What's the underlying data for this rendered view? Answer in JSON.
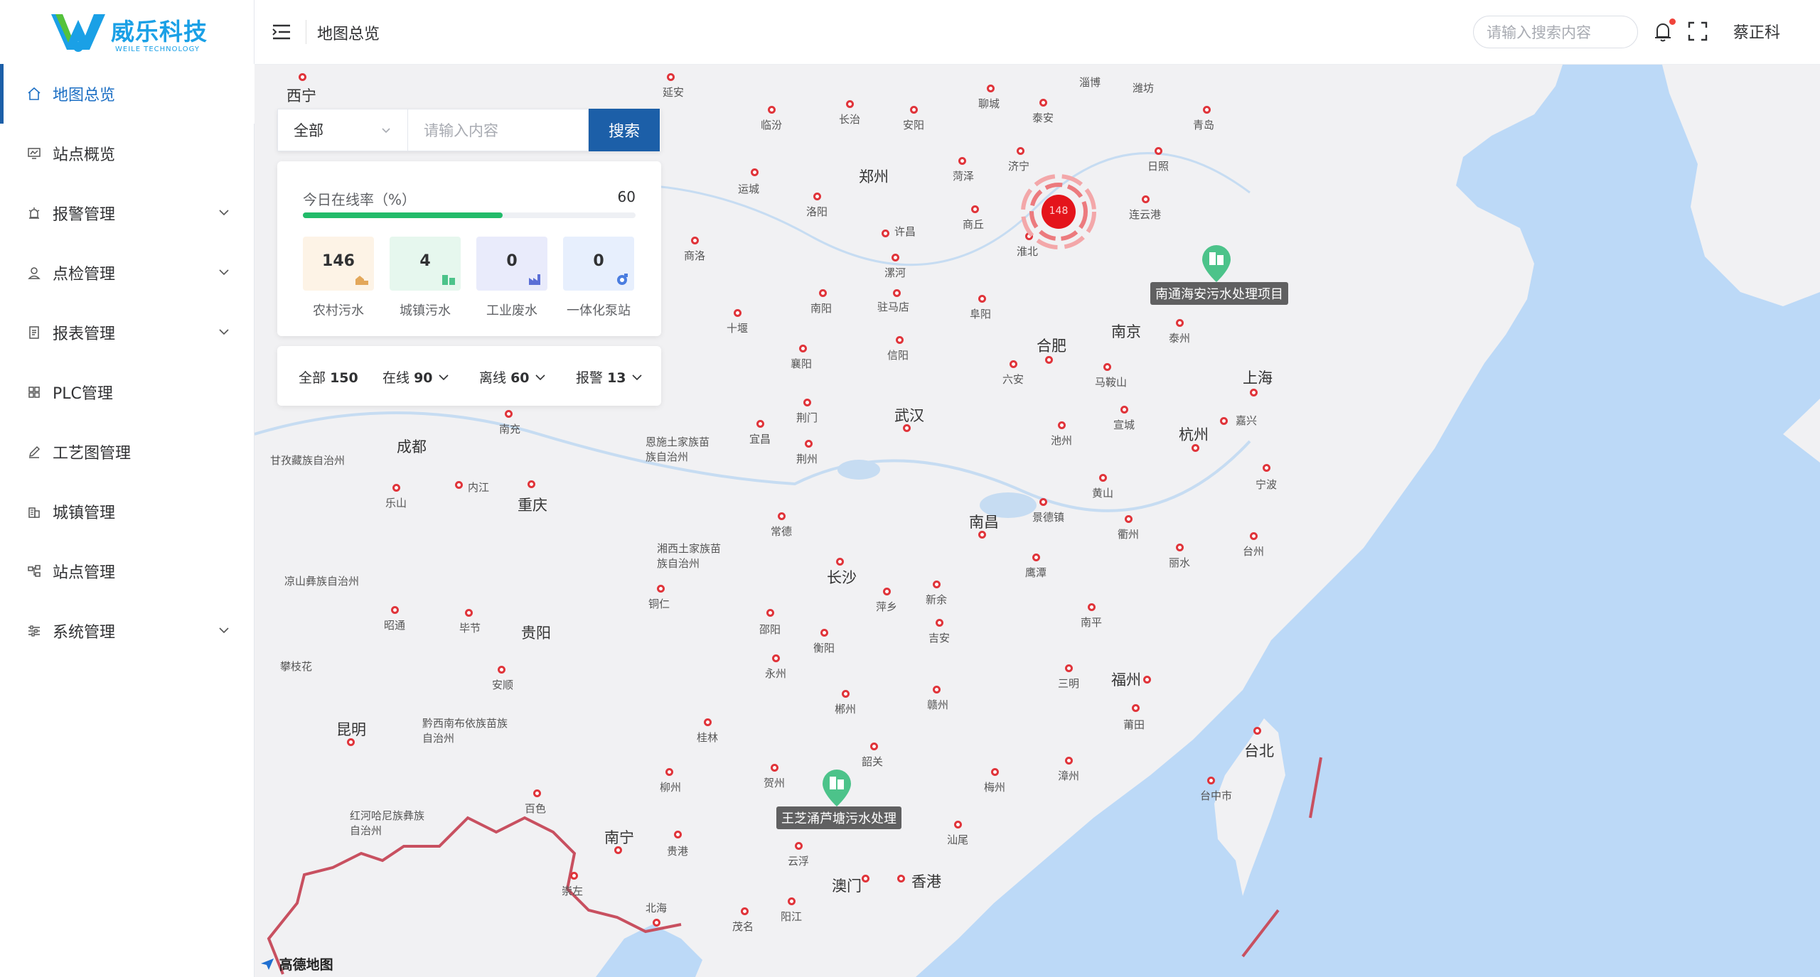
{
  "brand": {
    "name": "威乐科技",
    "sub": "WEILE TECHNOLOGY"
  },
  "sidebar": {
    "items": [
      {
        "label": "地图总览",
        "icon": "home-icon",
        "active": true,
        "expandable": false
      },
      {
        "label": "站点概览",
        "icon": "monitor-icon",
        "expandable": false
      },
      {
        "label": "报警管理",
        "icon": "alarm-icon",
        "expandable": true
      },
      {
        "label": "点检管理",
        "icon": "user-check-icon",
        "expandable": true
      },
      {
        "label": "报表管理",
        "icon": "report-icon",
        "expandable": true
      },
      {
        "label": "PLC管理",
        "icon": "grid-icon",
        "expandable": false
      },
      {
        "label": "工艺图管理",
        "icon": "pen-icon",
        "expandable": false
      },
      {
        "label": "城镇管理",
        "icon": "building-icon",
        "expandable": false
      },
      {
        "label": "站点管理",
        "icon": "sitemap-icon",
        "expandable": false
      },
      {
        "label": "系统管理",
        "icon": "settings-sliders-icon",
        "expandable": true
      }
    ]
  },
  "header": {
    "breadcrumb": "地图总览",
    "search_placeholder": "请输入搜索内容",
    "user": "蔡正科"
  },
  "map_search": {
    "select_value": "全部",
    "input_placeholder": "请输入内容",
    "button": "搜索"
  },
  "online": {
    "label": "今日在线率（%）",
    "value": "60",
    "progress": 0.6,
    "stats": [
      {
        "count": "146",
        "caption": "农村污水",
        "bg": "#fdf3e6",
        "icon": "rural-sewage-icon",
        "icon_color": "#e3a75a"
      },
      {
        "count": "4",
        "caption": "城镇污水",
        "bg": "#e6f7ee",
        "icon": "urban-sewage-icon",
        "icon_color": "#4cc38a"
      },
      {
        "count": "0",
        "caption": "工业废水",
        "bg": "#e9ebfb",
        "icon": "industrial-icon",
        "icon_color": "#5b6fd6"
      },
      {
        "count": "0",
        "caption": "一体化泵站",
        "bg": "#e7effd",
        "icon": "pump-icon",
        "icon_color": "#4a7de0"
      }
    ]
  },
  "filters": {
    "all_label": "全部",
    "all_count": "150",
    "online_label": "在线",
    "online_count": "90",
    "offline_label": "离线",
    "offline_count": "60",
    "alarm_label": "报警",
    "alarm_count": "13"
  },
  "map": {
    "cluster_count": "148",
    "pins": [
      "南通海安污水处理项目",
      "王芝涌芦塘污水处理"
    ],
    "attribution": "高德地图",
    "major_cities": [
      "西宁",
      "郑州",
      "成都",
      "重庆",
      "武汉",
      "合肥",
      "南京",
      "上海",
      "杭州",
      "长沙",
      "南昌",
      "贵阳",
      "昆明",
      "福州",
      "台北",
      "南宁",
      "澳门",
      "香港"
    ],
    "cities": [
      "延安",
      "临汾",
      "长治",
      "安阳",
      "聊城",
      "泰安",
      "淄博",
      "潍坊",
      "青岛",
      "日照",
      "济宁",
      "菏泽",
      "运城",
      "洛阳",
      "商丘",
      "连云港",
      "许昌",
      "淮北",
      "商洛",
      "漯河",
      "驻马店",
      "阜阳",
      "南阳",
      "十堰",
      "信阳",
      "泰州",
      "襄阳",
      "六安",
      "马鞍山",
      "荆门",
      "宜昌",
      "荆州",
      "南充",
      "内江",
      "乐山",
      "恩施土家族苗族自治州",
      "甘孜藏族自治州",
      "池州",
      "宣城",
      "嘉兴",
      "宁波",
      "黄山",
      "景德镇",
      "衢州",
      "丽水",
      "台州",
      "常德",
      "湘西土家族苗族自治州",
      "铜仁",
      "萍乡",
      "新余",
      "鹰潭",
      "南平",
      "吉安",
      "邵阳",
      "衡阳",
      "永州",
      "郴州",
      "赣州",
      "三明",
      "莆田",
      "毕节",
      "昭通",
      "凉山彝族自治州",
      "攀枝花",
      "安顺",
      "黔西南布依族苗族自治州",
      "桂林",
      "韶关",
      "梅州",
      "漳州",
      "台中市",
      "柳州",
      "贺州",
      "百色",
      "红河哈尼族彝族自治州",
      "贵港",
      "汕尾",
      "云浮",
      "崇左",
      "北海",
      "阳江",
      "茂名"
    ]
  }
}
